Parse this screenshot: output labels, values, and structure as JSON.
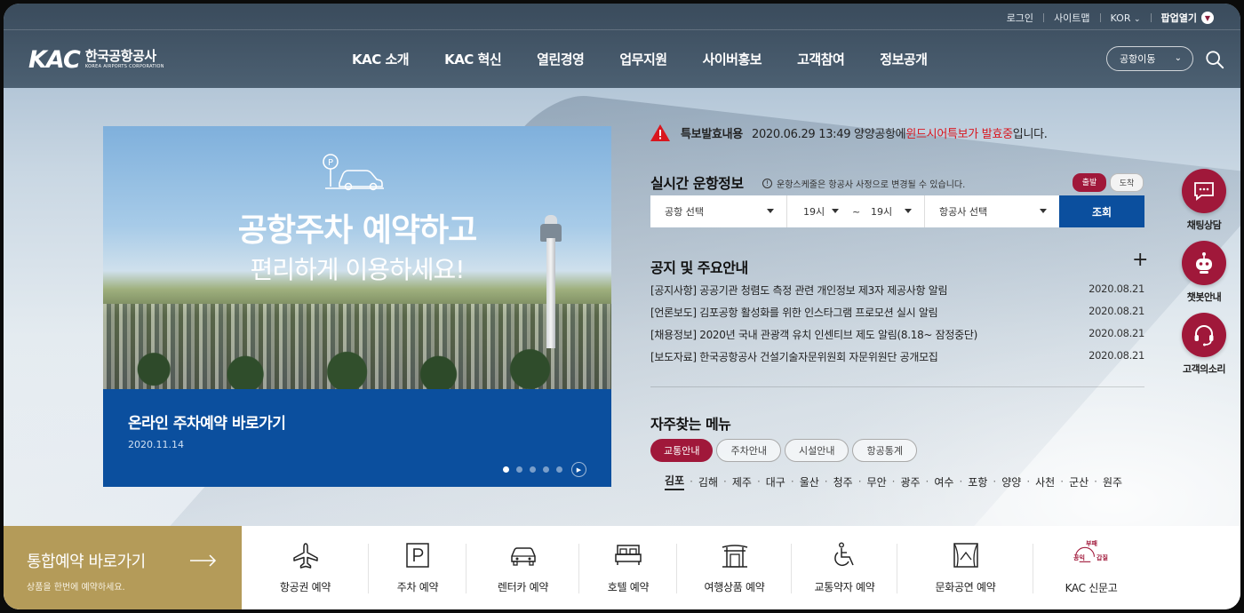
{
  "util": {
    "login": "로그인",
    "sitemap": "사이트맵",
    "lang": "KOR",
    "popup": "팝업열기"
  },
  "logo": {
    "mark": "KAC",
    "ko": "한국공항공사",
    "en": "KOREA AIRPORTS CORPORATION"
  },
  "gnb": [
    "KAC 소개",
    "KAC 혁신",
    "열린경영",
    "업무지원",
    "사이버홍보",
    "고객참여",
    "정보공개"
  ],
  "airport_move": "공항이동",
  "hero": {
    "title": "공항주차 예약하고",
    "subtitle": "편리하게 이용하세요!",
    "caption": "온라인 주차예약 바로가기",
    "date": "2020.11.14",
    "slides": 5,
    "active_slide": 1
  },
  "alert": {
    "label": "특보발효내용",
    "text_prefix": "2020.06.29 13:49 양양공항에 ",
    "text_red": "윈드시어특보가 발효중",
    "text_suffix": "입니다."
  },
  "flight": {
    "title": "실시간 운항정보",
    "note": "운항스케줄은 항공사 사정으로 변경될 수 있습니다.",
    "depart": "출발",
    "arrive": "도착",
    "airport_select": "공항 선택",
    "time_from": "19시",
    "tilde": "~",
    "time_to": "19시",
    "airline_select": "항공사 선택",
    "search": "조회"
  },
  "notice": {
    "title": "공지 및 주요안내",
    "items": [
      {
        "text": "[공지사항] 공공기관 청렴도 측정 관련 개인정보 제3자 제공사항 알림",
        "date": "2020.08.21"
      },
      {
        "text": "[언론보도] 김포공항 활성화를 위한 인스타그램 프로모션 실시 알림",
        "date": "2020.08.21"
      },
      {
        "text": "[채용정보] 2020년 국내 관광객 유치 인센티브 제도 알림(8.18~ 잠정중단)",
        "date": "2020.08.21"
      },
      {
        "text": "[보도자료] 한국공항공사 건설기술자문위원회 자문위원단 공개모집",
        "date": "2020.08.21"
      }
    ]
  },
  "freq": {
    "title": "자주찾는 메뉴",
    "tabs": [
      "교통안내",
      "주차안내",
      "시설안내",
      "항공통계"
    ],
    "cities": [
      "김포",
      "김해",
      "제주",
      "대구",
      "울산",
      "청주",
      "무안",
      "광주",
      "여수",
      "포항",
      "양양",
      "사천",
      "군산",
      "원주"
    ]
  },
  "floats": [
    "채팅상담",
    "챗봇안내",
    "고객의소리"
  ],
  "booking": {
    "title": "통합예약 바로가기",
    "sub": "상품을 한번에 예약하세요."
  },
  "quick": [
    "항공권 예약",
    "주차 예약",
    "렌터카 예약",
    "호텔 예약",
    "여행상품 예약",
    "교통약자 예약",
    "문화공연 예약",
    "KAC 신문고"
  ],
  "kac_badge": {
    "top": "부패",
    "left": "공익",
    "right": "갑질"
  },
  "colors": {
    "brand_red": "#a0183a",
    "brand_blue": "#0b4f9e",
    "gold": "#b49b59",
    "alert_red": "#d9161e"
  }
}
